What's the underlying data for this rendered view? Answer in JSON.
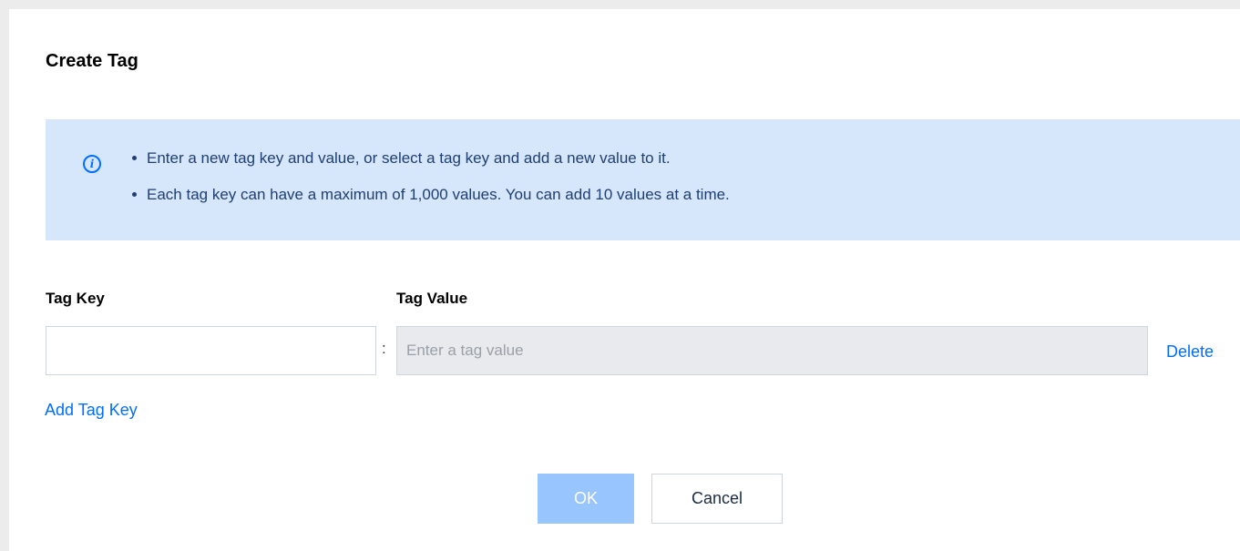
{
  "dialog": {
    "title": "Create Tag"
  },
  "notice": {
    "icon": "info-icon",
    "items": [
      "Enter a new tag key and value, or select a tag key and add a new value to it.",
      "Each tag key can have a maximum of 1,000 values. You can add 10 values at a time."
    ]
  },
  "form": {
    "tag_key_label": "Tag Key",
    "tag_value_label": "Tag Value",
    "tag_key_value": "",
    "tag_value_placeholder": "Enter a tag value",
    "separator": ":",
    "delete_label": "Delete",
    "add_tag_key_label": "Add Tag Key"
  },
  "actions": {
    "ok_label": "OK",
    "cancel_label": "Cancel"
  },
  "colors": {
    "accent": "#006eff",
    "notice_bg": "#d6e6fb",
    "ok_disabled": "#99c5ff"
  }
}
